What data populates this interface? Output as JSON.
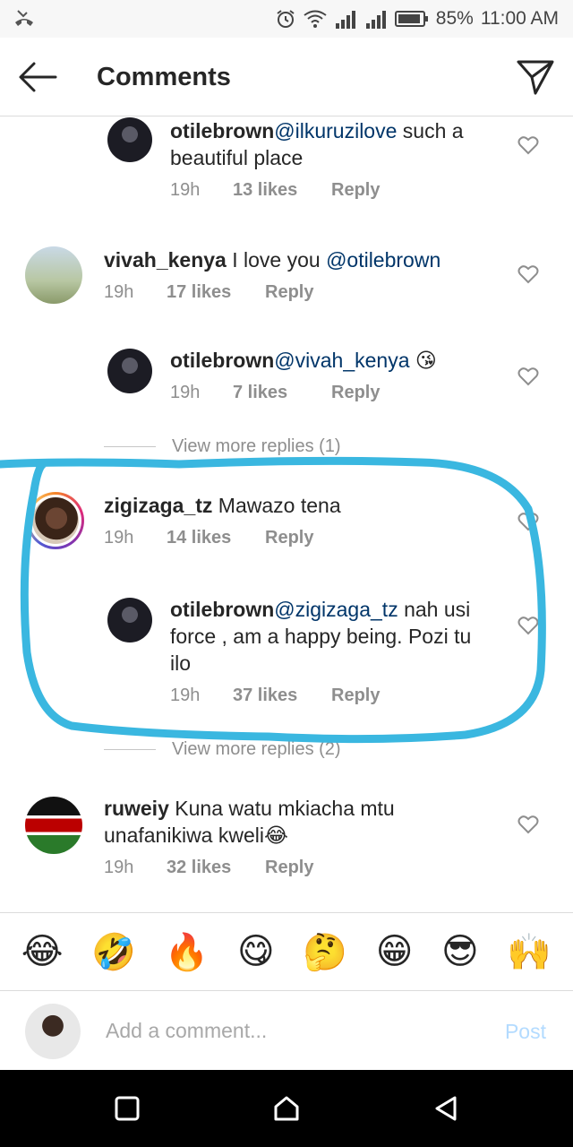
{
  "status_bar": {
    "battery": "85%",
    "time": "11:00 AM",
    "icons": [
      "missed-call-icon",
      "alarm-icon",
      "wifi-icon",
      "signal-icon",
      "signal-icon",
      "battery-icon"
    ]
  },
  "header": {
    "title": "Comments",
    "back_icon": "arrow-left-icon",
    "send_icon": "paper-plane-icon"
  },
  "comments": [
    {
      "username": "otilebrown",
      "mention": "@ilkuruzilove",
      "text_line1": " such a",
      "text_line2": "beautiful place",
      "time": "19h",
      "likes": "13 likes",
      "reply": "Reply",
      "is_reply": true
    },
    {
      "username": "vivah_kenya",
      "text": " I love you ",
      "mention": "@otilebrown",
      "time": "19h",
      "likes": "17 likes",
      "reply": "Reply",
      "is_reply": false
    },
    {
      "username": "otilebrown",
      "mention": "@vivah_kenya",
      "text": " 😘",
      "time": "19h",
      "likes": "7 likes",
      "reply": "Reply",
      "is_reply": true
    },
    {
      "username": "zigizaga_tz",
      "text": " Mawazo tena",
      "time": "19h",
      "likes": "14 likes",
      "reply": "Reply",
      "is_reply": false
    },
    {
      "username": "otilebrown",
      "mention": "@zigizaga_tz",
      "text_line1": " nah usi",
      "text_line2": "force , am a happy being. Pozi tu",
      "text_line3": "ilo",
      "time": "19h",
      "likes": "37 likes",
      "reply": "Reply",
      "is_reply": true
    },
    {
      "username": "ruweiy",
      "text_line1": " Kuna watu mkiacha mtu",
      "text_line2": "unafanikiwa kweli😂",
      "time": "19h",
      "likes": "32 likes",
      "reply": "Reply",
      "is_reply": false
    }
  ],
  "view_more": [
    {
      "label": "View more replies (1)"
    },
    {
      "label": "View more replies (2)"
    }
  ],
  "emoji_bar": [
    "😂",
    "🤣",
    "🔥",
    "😋",
    "🤔",
    "😁",
    "😎",
    "🙌"
  ],
  "input": {
    "placeholder": "Add a comment...",
    "post_label": "Post"
  },
  "colors": {
    "mention": "#003569",
    "meta": "#8e8e8e",
    "highlight": "#3ab7e0",
    "post_disabled": "#b3dbff"
  }
}
